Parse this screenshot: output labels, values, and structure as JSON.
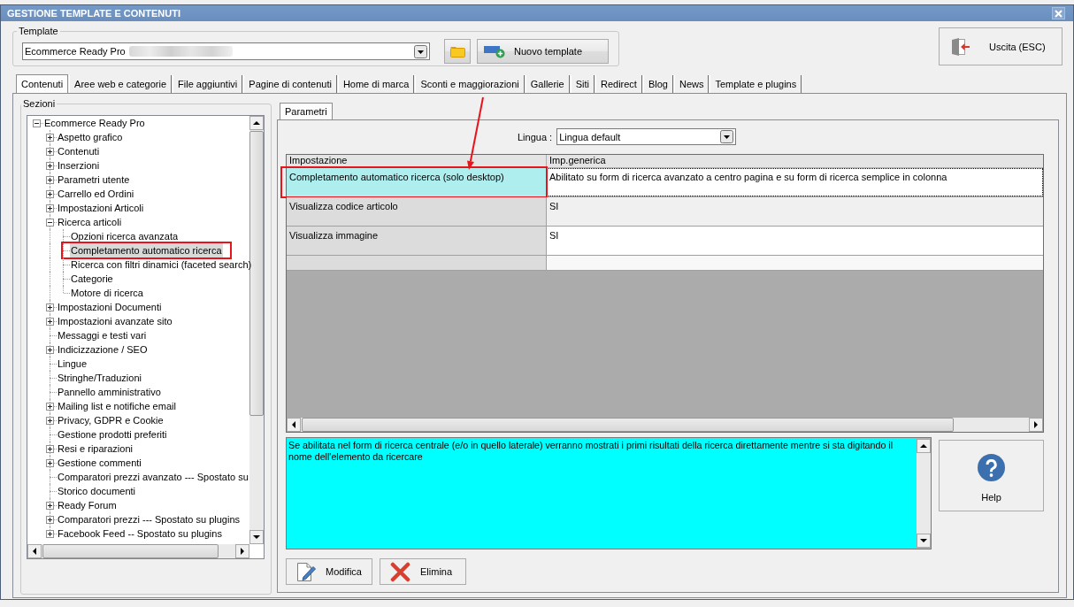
{
  "window": {
    "title": "GESTIONE TEMPLATE E CONTENUTI"
  },
  "template": {
    "label": "Template",
    "value": "Ecommerce Ready Pro",
    "value_blurred": true,
    "new_button": "Nuovo template"
  },
  "exit_button": "Uscita (ESC)",
  "tabs": [
    {
      "label": "Contenuti",
      "selected": true
    },
    {
      "label": "Aree web e categorie",
      "selected": false
    },
    {
      "label": "File aggiuntivi",
      "selected": false
    },
    {
      "label": "Pagine di contenuti",
      "selected": false
    },
    {
      "label": "Home di marca",
      "selected": false
    },
    {
      "label": "Sconti e maggiorazioni",
      "selected": false
    },
    {
      "label": "Gallerie",
      "selected": false
    },
    {
      "label": "Siti",
      "selected": false
    },
    {
      "label": "Redirect",
      "selected": false
    },
    {
      "label": "Blog",
      "selected": false
    },
    {
      "label": "News",
      "selected": false
    },
    {
      "label": "Template e plugins",
      "selected": false
    }
  ],
  "sections": {
    "label": "Sezioni",
    "tree": [
      {
        "label": "Ecommerce Ready Pro",
        "expanded": true,
        "selected": false,
        "highlighted": false,
        "children": [
          {
            "label": "Aspetto grafico",
            "expanded": false,
            "selected": false,
            "highlighted": false
          },
          {
            "label": "Contenuti",
            "expanded": false,
            "selected": false,
            "highlighted": false
          },
          {
            "label": "Inserzioni",
            "expanded": false,
            "selected": false,
            "highlighted": false
          },
          {
            "label": "Parametri utente",
            "expanded": false,
            "selected": false,
            "highlighted": false
          },
          {
            "label": "Carrello ed Ordini",
            "expanded": false,
            "selected": false,
            "highlighted": false
          },
          {
            "label": "Impostazioni Articoli",
            "expanded": false,
            "selected": false,
            "highlighted": false
          },
          {
            "label": "Ricerca articoli",
            "expanded": true,
            "selected": false,
            "highlighted": false,
            "children": [
              {
                "label": "Opzioni ricerca avanzata",
                "selected": false,
                "highlighted": false
              },
              {
                "label": "Completamento automatico ricerca",
                "selected": true,
                "highlighted": true
              },
              {
                "label": "Ricerca con filtri dinamici (faceted search)",
                "selected": false,
                "highlighted": false
              },
              {
                "label": "Categorie",
                "selected": false,
                "highlighted": false
              },
              {
                "label": "Motore di ricerca",
                "selected": false,
                "highlighted": false
              }
            ]
          },
          {
            "label": "Impostazioni Documenti",
            "expanded": false,
            "selected": false,
            "highlighted": false
          },
          {
            "label": "Impostazioni avanzate sito",
            "expanded": false,
            "selected": false,
            "highlighted": false
          },
          {
            "label": "Messaggi e testi vari",
            "selected": false,
            "highlighted": false
          },
          {
            "label": "Indicizzazione / SEO",
            "expanded": false,
            "selected": false,
            "highlighted": false
          },
          {
            "label": "Lingue",
            "selected": false,
            "highlighted": false
          },
          {
            "label": "Stringhe/Traduzioni",
            "selected": false,
            "highlighted": false
          },
          {
            "label": "Pannello amministrativo",
            "selected": false,
            "highlighted": false
          },
          {
            "label": "Mailing list e notifiche email",
            "expanded": false,
            "selected": false,
            "highlighted": false
          },
          {
            "label": "Privacy, GDPR e Cookie",
            "expanded": false,
            "selected": false,
            "highlighted": false
          },
          {
            "label": "Gestione prodotti preferiti",
            "selected": false,
            "highlighted": false
          },
          {
            "label": "Resi e riparazioni",
            "expanded": false,
            "selected": false,
            "highlighted": false
          },
          {
            "label": "Gestione commenti",
            "expanded": false,
            "selected": false,
            "highlighted": false
          },
          {
            "label": "Comparatori prezzi avanzato --- Spostato su",
            "selected": false,
            "highlighted": false
          },
          {
            "label": "Storico documenti",
            "selected": false,
            "highlighted": false
          },
          {
            "label": "Ready Forum",
            "expanded": false,
            "selected": false,
            "highlighted": false
          },
          {
            "label": "Comparatori prezzi --- Spostato su plugins",
            "expanded": false,
            "selected": false,
            "highlighted": false
          },
          {
            "label": "Facebook Feed -- Spostato su plugins",
            "expanded": false,
            "selected": false,
            "highlighted": false
          }
        ]
      }
    ]
  },
  "parameters": {
    "tabs": [
      {
        "label": "Parametri",
        "selected": true
      }
    ],
    "language": {
      "label": "Lingua :",
      "value": "Lingua default"
    },
    "grid": {
      "columns": [
        "Impostazione",
        "Imp.generica"
      ],
      "rows": [
        {
          "setting": "Completamento automatico ricerca (solo desktop)",
          "value": "Abilitato su form di ricerca avanzato a centro pagina e su form di ricerca semplice in colonna",
          "selected": true,
          "highlighted": true
        },
        {
          "setting": "Visualizza codice articolo",
          "value": "SI",
          "selected": false,
          "highlighted": false
        },
        {
          "setting": "Visualizza immagine",
          "value": "SI",
          "selected": false,
          "highlighted": false
        }
      ]
    },
    "callout_arrow": true,
    "description": "Se abilitata nel form di ricerca centrale (e/o in quello laterale) verranno mostrati i primi risultati della ricerca direttamente mentre si sta digitando il nome dell'elemento da ricercare",
    "help_button": "Help",
    "actions": [
      {
        "kind": "edit",
        "label": "Modifica"
      },
      {
        "kind": "delete",
        "label": "Elimina"
      }
    ]
  }
}
